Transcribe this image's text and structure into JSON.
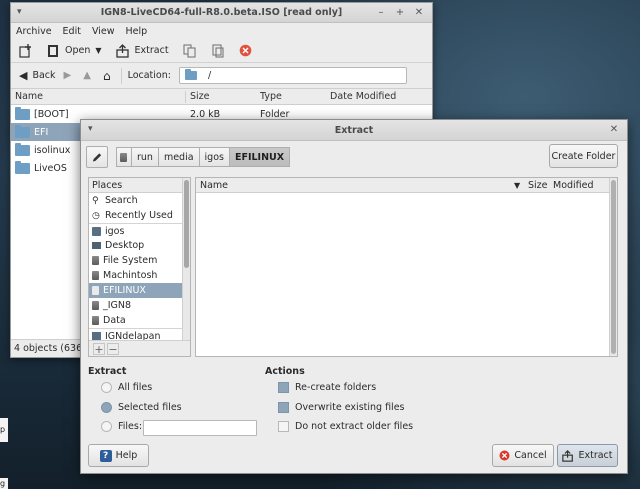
{
  "archive": {
    "title": "IGN8-LiveCD64-full-R8.0.beta.ISO [read only]",
    "menus": [
      "Archive",
      "Edit",
      "View",
      "Help"
    ],
    "toolbar": {
      "open_label": "Open",
      "extract_label": "Extract"
    },
    "nav": {
      "back_label": "Back",
      "location_label": "Location:",
      "location_value": "/"
    },
    "columns": {
      "name": "Name",
      "size": "Size",
      "type": "Type",
      "date": "Date Modified"
    },
    "rows": [
      {
        "name": "[BOOT]",
        "size": "2.0 kB",
        "type": "Folder",
        "date": ""
      },
      {
        "name": "EFI",
        "size": "",
        "type": "",
        "date": ""
      },
      {
        "name": "isolinux",
        "size": "",
        "type": "",
        "date": ""
      },
      {
        "name": "LiveOS",
        "size": "",
        "type": "",
        "date": ""
      }
    ],
    "status": "4 objects (636."
  },
  "extract": {
    "title": "Extract",
    "path": [
      "run",
      "media",
      "igos",
      "EFILINUX"
    ],
    "create_folder_label": "Create Folder",
    "places": {
      "header": "Places",
      "items": [
        "Search",
        "Recently Used",
        "igos",
        "Desktop",
        "File System",
        "Machintosh",
        "EFILINUX",
        "_IGN8",
        "Data",
        "IGNdelapan"
      ]
    },
    "files": {
      "name": "Name",
      "size": "Size",
      "modified": "Modified"
    },
    "extract_section": {
      "label": "Extract",
      "all_files": "All files",
      "selected_files": "Selected files",
      "files_label": "Files:",
      "files_value": ""
    },
    "actions_section": {
      "label": "Actions",
      "recreate": "Re-create folders",
      "overwrite": "Overwrite existing files",
      "no_older": "Do not extract older files"
    },
    "buttons": {
      "help": "Help",
      "cancel": "Cancel",
      "extract": "Extract"
    }
  },
  "desktop_marks": [
    "p",
    "g"
  ],
  "colors": {
    "selection": "#8ea4b9",
    "folder": "#6e9ec4",
    "help_icon": "#2f5d9a",
    "cancel_icon": "#d83b2d"
  }
}
